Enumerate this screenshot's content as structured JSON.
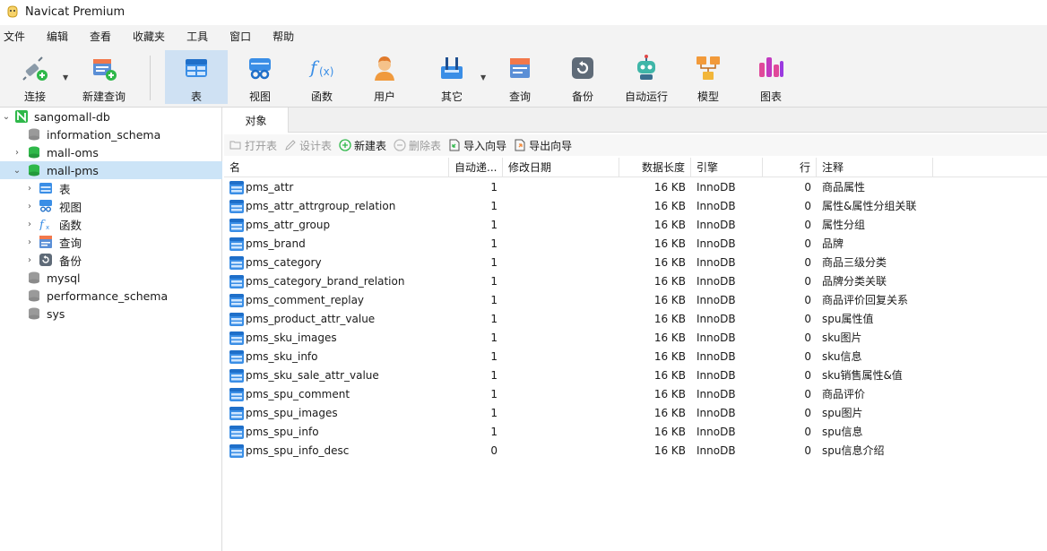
{
  "window": {
    "title": "Navicat Premium"
  },
  "menu": [
    "文件",
    "编辑",
    "查看",
    "收藏夹",
    "工具",
    "窗口",
    "帮助"
  ],
  "toolbar": {
    "connect": "连接",
    "new_query": "新建查询",
    "table": "表",
    "view": "视图",
    "function": "函数",
    "user": "用户",
    "other": "其它",
    "query": "查询",
    "backup": "备份",
    "automation": "自动运行",
    "model": "模型",
    "chart": "图表"
  },
  "sidebar": {
    "connection": "sangomall-db",
    "databases": [
      "information_schema",
      "mall-oms",
      "mall-pms",
      "mysql",
      "performance_schema",
      "sys"
    ],
    "pms_children": [
      "表",
      "视图",
      "函数",
      "查询",
      "备份"
    ]
  },
  "tabs": {
    "objects": "对象"
  },
  "actions": {
    "open_table": "打开表",
    "design_table": "设计表",
    "new_table": "新建表",
    "delete_table": "删除表",
    "import_wizard": "导入向导",
    "export_wizard": "导出向导"
  },
  "columns": {
    "name": "名",
    "auto_inc": "自动递...",
    "modified": "修改日期",
    "data_length": "数据长度",
    "engine": "引擎",
    "rows": "行",
    "comment": "注释"
  },
  "tables": [
    {
      "name": "pms_attr",
      "auto_inc": "1",
      "modified": "",
      "data_length": "16 KB",
      "engine": "InnoDB",
      "rows": "0",
      "comment": "商品属性"
    },
    {
      "name": "pms_attr_attrgroup_relation",
      "auto_inc": "1",
      "modified": "",
      "data_length": "16 KB",
      "engine": "InnoDB",
      "rows": "0",
      "comment": "属性&属性分组关联"
    },
    {
      "name": "pms_attr_group",
      "auto_inc": "1",
      "modified": "",
      "data_length": "16 KB",
      "engine": "InnoDB",
      "rows": "0",
      "comment": "属性分组"
    },
    {
      "name": "pms_brand",
      "auto_inc": "1",
      "modified": "",
      "data_length": "16 KB",
      "engine": "InnoDB",
      "rows": "0",
      "comment": "品牌"
    },
    {
      "name": "pms_category",
      "auto_inc": "1",
      "modified": "",
      "data_length": "16 KB",
      "engine": "InnoDB",
      "rows": "0",
      "comment": "商品三级分类"
    },
    {
      "name": "pms_category_brand_relation",
      "auto_inc": "1",
      "modified": "",
      "data_length": "16 KB",
      "engine": "InnoDB",
      "rows": "0",
      "comment": "品牌分类关联"
    },
    {
      "name": "pms_comment_replay",
      "auto_inc": "1",
      "modified": "",
      "data_length": "16 KB",
      "engine": "InnoDB",
      "rows": "0",
      "comment": "商品评价回复关系"
    },
    {
      "name": "pms_product_attr_value",
      "auto_inc": "1",
      "modified": "",
      "data_length": "16 KB",
      "engine": "InnoDB",
      "rows": "0",
      "comment": "spu属性值"
    },
    {
      "name": "pms_sku_images",
      "auto_inc": "1",
      "modified": "",
      "data_length": "16 KB",
      "engine": "InnoDB",
      "rows": "0",
      "comment": "sku图片"
    },
    {
      "name": "pms_sku_info",
      "auto_inc": "1",
      "modified": "",
      "data_length": "16 KB",
      "engine": "InnoDB",
      "rows": "0",
      "comment": "sku信息"
    },
    {
      "name": "pms_sku_sale_attr_value",
      "auto_inc": "1",
      "modified": "",
      "data_length": "16 KB",
      "engine": "InnoDB",
      "rows": "0",
      "comment": "sku销售属性&值"
    },
    {
      "name": "pms_spu_comment",
      "auto_inc": "1",
      "modified": "",
      "data_length": "16 KB",
      "engine": "InnoDB",
      "rows": "0",
      "comment": "商品评价"
    },
    {
      "name": "pms_spu_images",
      "auto_inc": "1",
      "modified": "",
      "data_length": "16 KB",
      "engine": "InnoDB",
      "rows": "0",
      "comment": "spu图片"
    },
    {
      "name": "pms_spu_info",
      "auto_inc": "1",
      "modified": "",
      "data_length": "16 KB",
      "engine": "InnoDB",
      "rows": "0",
      "comment": "spu信息"
    },
    {
      "name": "pms_spu_info_desc",
      "auto_inc": "0",
      "modified": "",
      "data_length": "16 KB",
      "engine": "InnoDB",
      "rows": "0",
      "comment": "spu信息介绍"
    }
  ],
  "colors": {
    "accent": "#cce4f7",
    "toolbar_active": "#cfe1f3",
    "db_green": "#2fb84a",
    "table_blue": "#2b7fd6"
  }
}
